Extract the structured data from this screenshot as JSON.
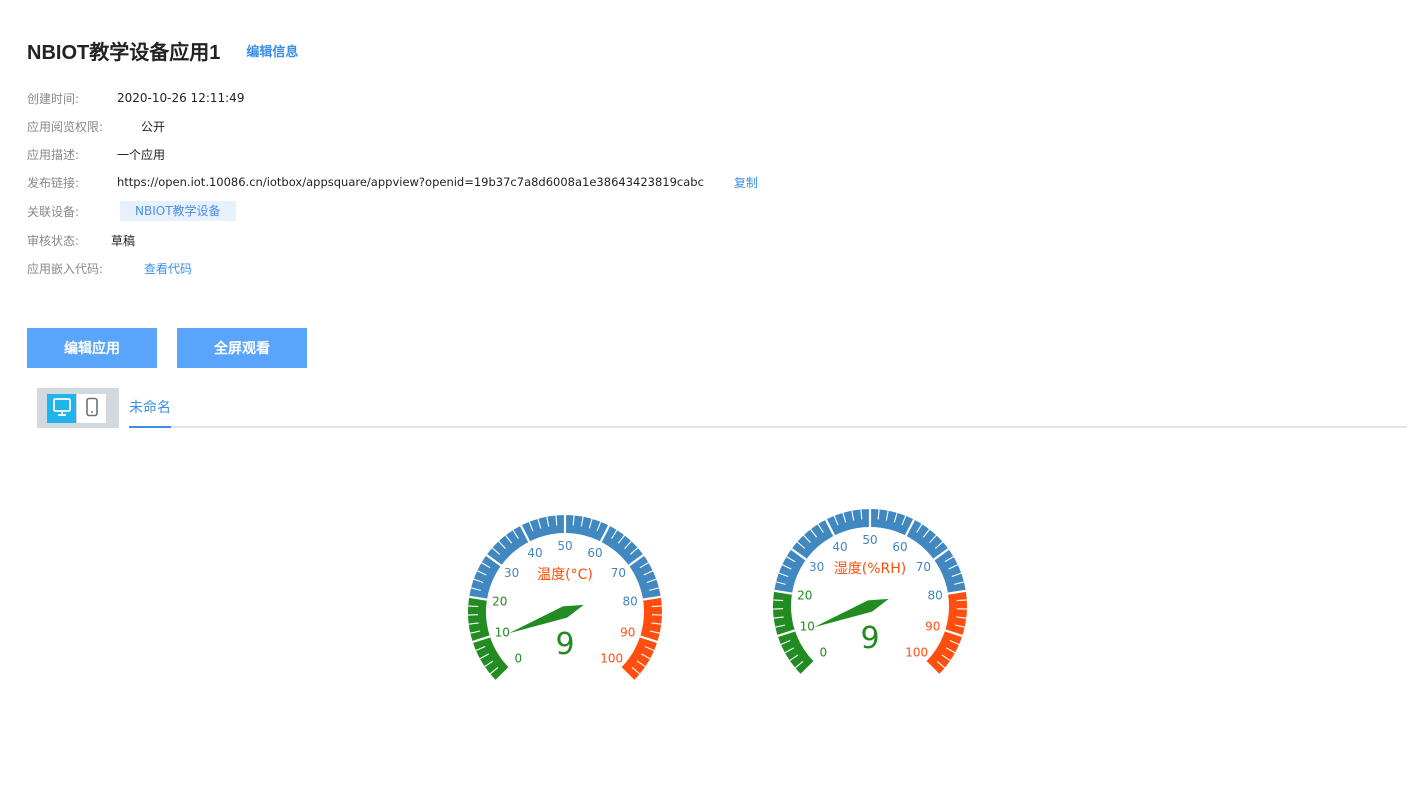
{
  "app": {
    "title": "NBIOT教学设备应用1",
    "edit_info_label": "编辑信息"
  },
  "info": {
    "created_label": "创建时间:",
    "created_value": "2020-10-26 12:11:49",
    "permission_label": "应用阅览权限:",
    "permission_value": "公开",
    "description_label": "应用描述:",
    "description_value": "一个应用",
    "publish_label": "发布链接:",
    "publish_value": "https://open.iot.10086.cn/iotbox/appsquare/appview?openid=19b37c7a8d6008a1e38643423819cabc",
    "copy_label": "复制",
    "device_label": "关联设备:",
    "device_tag": "NBIOT教学设备",
    "status_label": "审核状态:",
    "status_value": "草稿",
    "embed_label": "应用嵌入代码:",
    "embed_link": "查看代码"
  },
  "buttons": {
    "edit_app": "编辑应用",
    "fullscreen": "全屏观看"
  },
  "device_switch": {
    "pc_icon": "monitor-icon",
    "mobile_icon": "mobile-phone-icon",
    "active": "pc"
  },
  "tabs": [
    {
      "label": "未命名",
      "active": true
    }
  ],
  "colors": {
    "accent": "#3d8fe6",
    "button": "#5aa5fc",
    "switch_active": "#20b3ec",
    "gauge_green": "#228b22",
    "gauge_blue": "#4187c0",
    "gauge_red": "#ff4e0f"
  },
  "gauges": [
    {
      "title": "温度(°C)",
      "value": 9,
      "value_text": "9",
      "min": 0,
      "max": 100,
      "tick_labels": [
        "0",
        "10",
        "20",
        "30",
        "40",
        "50",
        "60",
        "70",
        "80",
        "90",
        "100"
      ],
      "bands": [
        {
          "from": 0,
          "to": 20,
          "color": "#228b22"
        },
        {
          "from": 20,
          "to": 80,
          "color": "#4187c0"
        },
        {
          "from": 80,
          "to": 100,
          "color": "#ff4e0f"
        }
      ]
    },
    {
      "title": "湿度(%RH)",
      "value": 9,
      "value_text": "9",
      "min": 0,
      "max": 100,
      "tick_labels": [
        "0",
        "10",
        "20",
        "30",
        "40",
        "50",
        "60",
        "70",
        "80",
        "90",
        "100"
      ],
      "bands": [
        {
          "from": 0,
          "to": 20,
          "color": "#228b22"
        },
        {
          "from": 20,
          "to": 80,
          "color": "#4187c0"
        },
        {
          "from": 80,
          "to": 100,
          "color": "#ff4e0f"
        }
      ]
    }
  ]
}
